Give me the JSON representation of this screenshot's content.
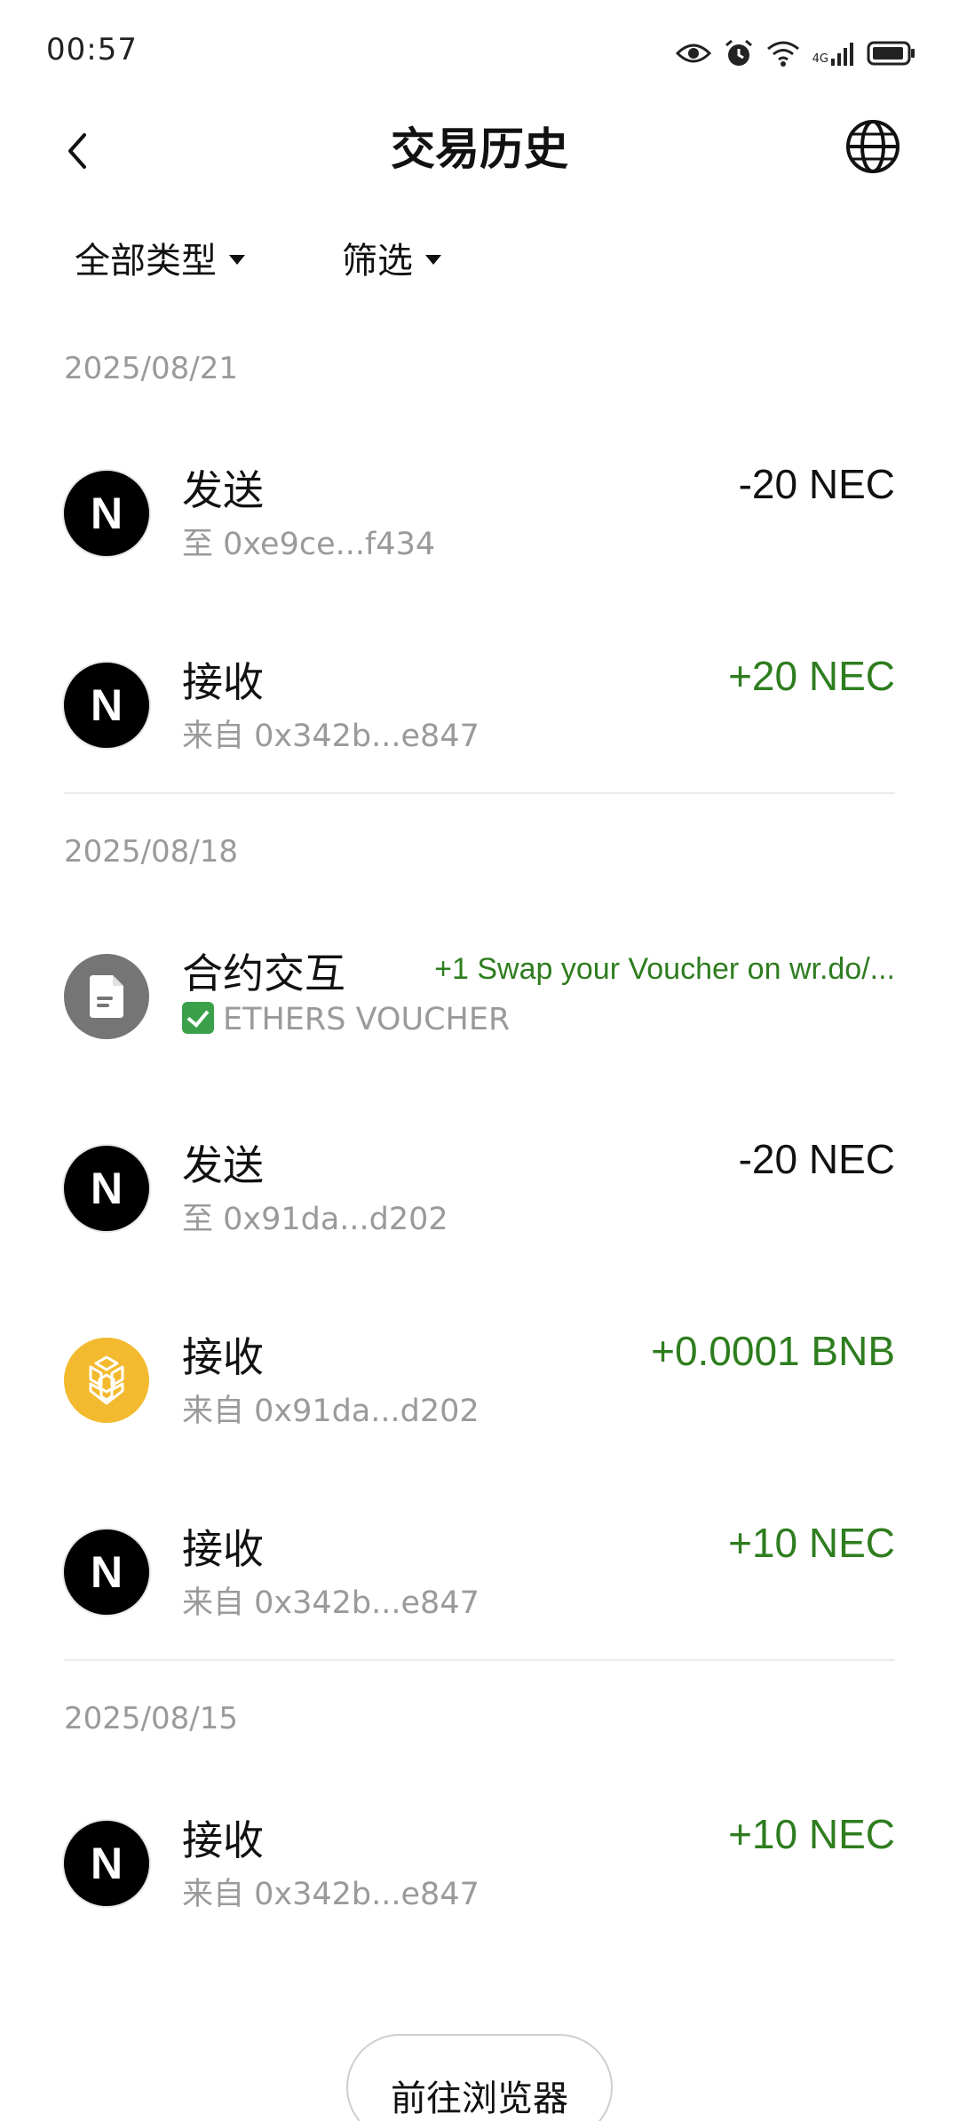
{
  "status_bar": {
    "time": "00:57",
    "network_label": "4G",
    "icons": [
      "eye-icon",
      "alarm-icon",
      "wifi-icon",
      "signal-icon",
      "battery-icon"
    ]
  },
  "header": {
    "title": "交易历史",
    "back_icon": "back-chevron-icon",
    "globe_icon": "globe-icon"
  },
  "filters": {
    "type_label": "全部类型",
    "screen_label": "筛选"
  },
  "colors": {
    "positive": "#2e7d1f",
    "muted": "#9a9a9a",
    "bnb": "#f3ba2f",
    "contract": "#757575"
  },
  "groups": [
    {
      "date": "2025/08/21",
      "transactions": [
        {
          "icon": "nec",
          "avatar_letter": "N",
          "title": "发送",
          "subtitle": "至 0xe9ce...f434",
          "amount": "-20 NEC",
          "positive": false
        },
        {
          "icon": "nec",
          "avatar_letter": "N",
          "title": "接收",
          "subtitle": "来自 0x342b...e847",
          "amount": "+20 NEC",
          "positive": true
        }
      ]
    },
    {
      "date": "2025/08/18",
      "transactions": [
        {
          "icon": "contract",
          "title": "合约交互",
          "subtitle": "ETHERS VOUCHER",
          "subtitle_check": true,
          "amount": "+1 Swap your Voucher on wr.do/...",
          "positive": true,
          "small": true
        },
        {
          "icon": "nec",
          "avatar_letter": "N",
          "title": "发送",
          "subtitle": "至 0x91da...d202",
          "amount": "-20 NEC",
          "positive": false
        },
        {
          "icon": "bnb",
          "title": "接收",
          "subtitle": "来自 0x91da...d202",
          "amount": "+0.0001 BNB",
          "positive": true
        },
        {
          "icon": "nec",
          "avatar_letter": "N",
          "title": "接收",
          "subtitle": "来自 0x342b...e847",
          "amount": "+10 NEC",
          "positive": true
        }
      ]
    },
    {
      "date": "2025/08/15",
      "transactions": [
        {
          "icon": "nec",
          "avatar_letter": "N",
          "title": "接收",
          "subtitle": "来自 0x342b...e847",
          "amount": "+10 NEC",
          "positive": true
        }
      ]
    }
  ],
  "browser_button": "前往浏览器"
}
